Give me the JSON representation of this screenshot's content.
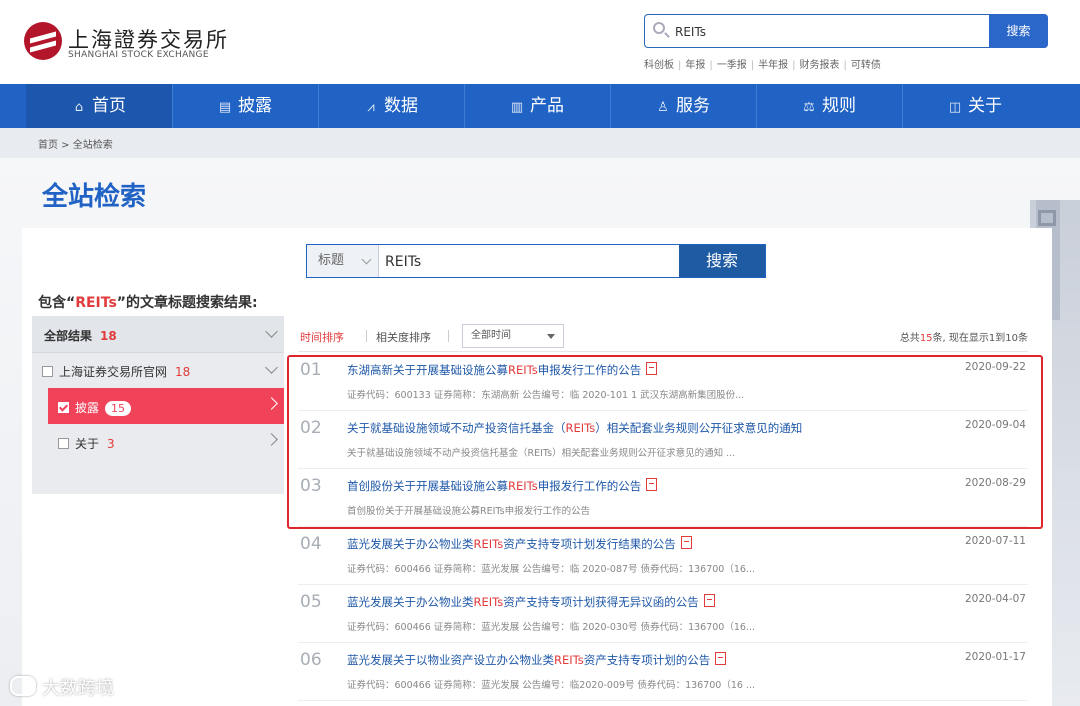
{
  "header": {
    "logo_cn": "上海證券交易所",
    "logo_en": "SHANGHAI STOCK EXCHANGE",
    "search_value": "REITs",
    "search_button": "搜索",
    "quick_links": [
      "科创板",
      "年报",
      "一季报",
      "半年报",
      "财务报表",
      "可转债"
    ]
  },
  "nav": {
    "items": [
      {
        "label": "首页",
        "icon": "home-icon"
      },
      {
        "label": "披露",
        "icon": "document-icon"
      },
      {
        "label": "数据",
        "icon": "chart-icon"
      },
      {
        "label": "产品",
        "icon": "bar-chart-icon"
      },
      {
        "label": "服务",
        "icon": "user-icon"
      },
      {
        "label": "规则",
        "icon": "scale-icon"
      },
      {
        "label": "关于",
        "icon": "book-icon"
      }
    ]
  },
  "breadcrumb": "首页 > 全站检索",
  "page_title": "全站检索",
  "search": {
    "type": "标题",
    "value": "REITs",
    "button": "搜索"
  },
  "result_caption": {
    "prefix": "包含“",
    "keyword": "REITs",
    "suffix": "”的文章标题搜索结果:"
  },
  "sidebar": {
    "all_label": "全部结果",
    "all_count": "18",
    "site_label": "上海证券交易所官网",
    "site_count": "18",
    "disclosure_label": "披露",
    "disclosure_count": "15",
    "about_label": "关于",
    "about_count": "3"
  },
  "sort": {
    "time": "时间排序",
    "relevance": "相关度排序",
    "time_range": "全部时间",
    "total_prefix": "总共",
    "total_count": "15",
    "total_suffix": "条, 现在显示1到10条"
  },
  "results": [
    {
      "num": "01",
      "pre": "东湖高新关于开展基础设施公募",
      "hl": "REITs",
      "post": "申报发行工作的公告",
      "pdf": true,
      "date": "2020-09-22",
      "desc": "证券代码：600133 证券简称：东湖高新 公告编号：临 2020-101 1 武汉东湖高新集团股份..."
    },
    {
      "num": "02",
      "pre": "关于就基础设施领域不动产投资信托基金（",
      "hl": "REITs",
      "post": "）相关配套业务规则公开征求意见的通知",
      "pdf": false,
      "date": "2020-09-04",
      "desc": "关于就基础设施领域不动产投资信托基金（REITs）相关配套业务规则公开征求意见的通知 ..."
    },
    {
      "num": "03",
      "pre": "首创股份关于开展基础设施公募",
      "hl": "REITs",
      "post": "申报发行工作的公告",
      "pdf": true,
      "date": "2020-08-29",
      "desc": "首创股份关于开展基础设施公募REITs申报发行工作的公告"
    },
    {
      "num": "04",
      "pre": "蓝光发展关于办公物业类",
      "hl": "REITs",
      "post": "资产支持专项计划发行结果的公告",
      "pdf": true,
      "date": "2020-07-11",
      "desc": "证券代码：600466 证券简称：蓝光发展 公告编号：临 2020-087号 债券代码：136700（16..."
    },
    {
      "num": "05",
      "pre": "蓝光发展关于办公物业类",
      "hl": "REITs",
      "post": "资产支持专项计划获得无异议函的公告",
      "pdf": true,
      "date": "2020-04-07",
      "desc": "证券代码：600466 证券简称：蓝光发展 公告编号：临 2020-030号 债券代码：136700（16..."
    },
    {
      "num": "06",
      "pre": "蓝光发展关于以物业资产设立办公物业类",
      "hl": "REITs",
      "post": "资产支持专项计划的公告",
      "pdf": true,
      "date": "2020-01-17",
      "desc": "证券代码：600466 证券简称：蓝光发展 公告编号：临2020-009号 债券代码：136700（16 ..."
    }
  ],
  "watermark": "大数跨境"
}
